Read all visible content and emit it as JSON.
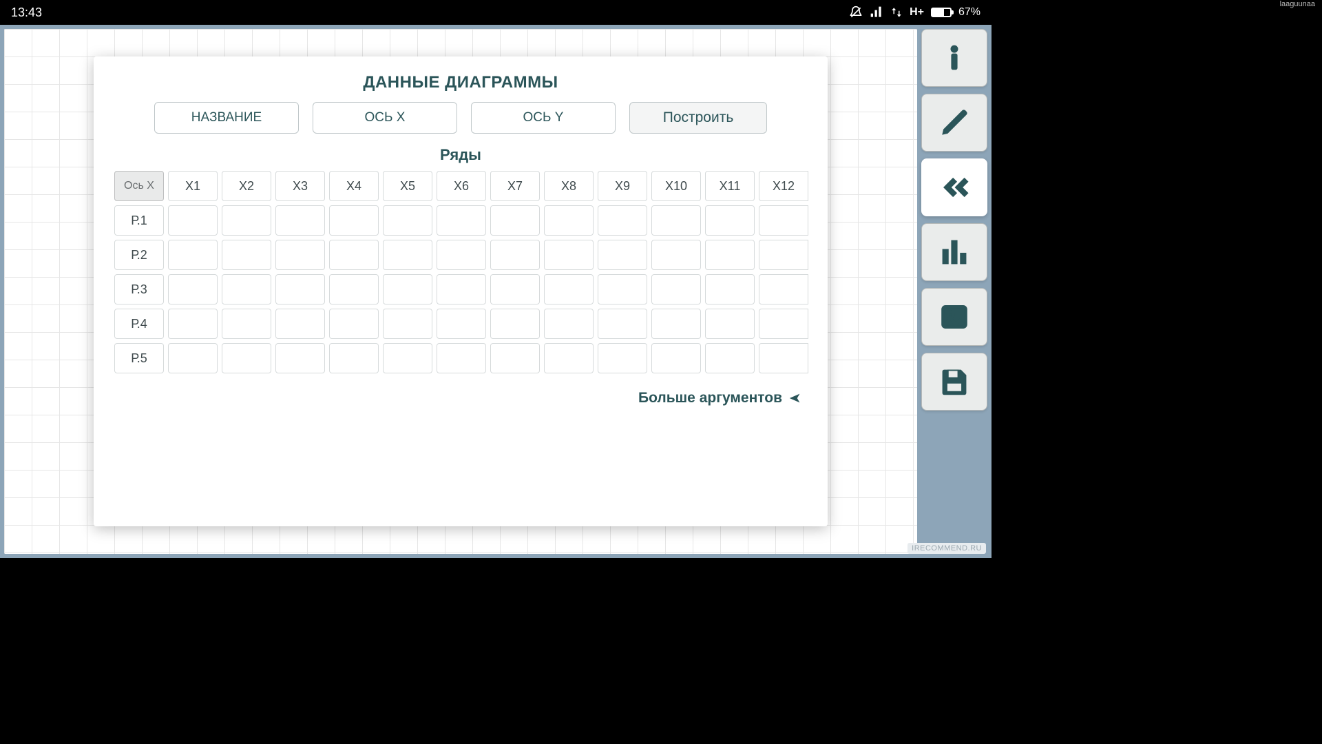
{
  "statusbar": {
    "time": "13:43",
    "network_label": "H+",
    "battery_pct": "67%",
    "username": "laaguunaa"
  },
  "dialog": {
    "title": "ДАННЫЕ ДИАГРАММЫ",
    "name_placeholder": "НАЗВАНИЕ",
    "xaxis_placeholder": "ОСЬ X",
    "yaxis_placeholder": "ОСЬ Y",
    "build_label": "Построить",
    "rows_title": "Ряды",
    "axis_head": "Ось X",
    "col_headers": [
      "X1",
      "X2",
      "X3",
      "X4",
      "X5",
      "X6",
      "X7",
      "X8",
      "X9",
      "X10",
      "X11",
      "X12"
    ],
    "row_labels": [
      "Р.1",
      "Р.2",
      "Р.3",
      "Р.4",
      "Р.5"
    ],
    "more_label": "Больше аргументов"
  },
  "watermark": "IRECOMMEND.RU"
}
